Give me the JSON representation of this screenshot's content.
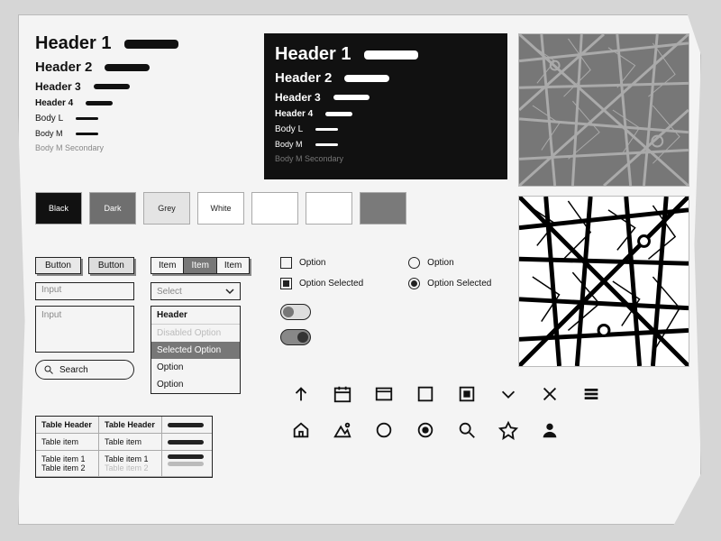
{
  "typography": {
    "h1": "Header 1",
    "h2": "Header 2",
    "h3": "Header 3",
    "h4": "Header 4",
    "bodyL": "Body L",
    "bodyM": "Body M",
    "secondary": "Body M Secondary"
  },
  "swatches": [
    {
      "label": "Black",
      "bg": "#111111",
      "fg": "#ffffff"
    },
    {
      "label": "Dark",
      "bg": "#6f6f6f",
      "fg": "#ffffff"
    },
    {
      "label": "Grey",
      "bg": "#e4e4e4",
      "fg": "#222222"
    },
    {
      "label": "White",
      "bg": "#ffffff",
      "fg": "#222222"
    },
    {
      "label": "",
      "bg": "#ffffff",
      "fg": "#222222"
    },
    {
      "label": "",
      "bg": "#ffffff",
      "fg": "#222222"
    },
    {
      "label": "",
      "bg": "#7a7a7a",
      "fg": "#222222"
    }
  ],
  "buttons": {
    "default": "Button",
    "hover": "Button"
  },
  "segmented": [
    "Item",
    "Item",
    "Item"
  ],
  "segmentedSelected": 1,
  "inputs": {
    "text": "Input",
    "textarea": "Input",
    "search": "Search",
    "select": "Select"
  },
  "listbox": {
    "header": "Header",
    "options": [
      {
        "label": "Disabled Option",
        "state": "disabled"
      },
      {
        "label": "Selected Option",
        "state": "selected"
      },
      {
        "label": "Option",
        "state": "default"
      },
      {
        "label": "Option",
        "state": "default"
      }
    ]
  },
  "table": {
    "headers": [
      "Table Header",
      "Table Header"
    ],
    "row1": [
      "Table item",
      "Table item"
    ],
    "row2a": [
      "Table item 1",
      "Table item 1"
    ],
    "row2b": [
      "Table item 2",
      "Table item 2"
    ]
  },
  "options": {
    "checkbox": {
      "unchecked": "Option",
      "checked": "Option Selected"
    },
    "radio": {
      "unchecked": "Option",
      "checked": "Option Selected"
    }
  },
  "iconNames": [
    "arrow-up-icon",
    "calendar-icon",
    "window-icon",
    "square-icon",
    "square-filled-icon",
    "chevron-down-icon",
    "close-icon",
    "menu-icon",
    "home-icon",
    "image-icon",
    "circle-icon",
    "radio-on-icon",
    "search-icon",
    "star-icon",
    "user-icon"
  ]
}
